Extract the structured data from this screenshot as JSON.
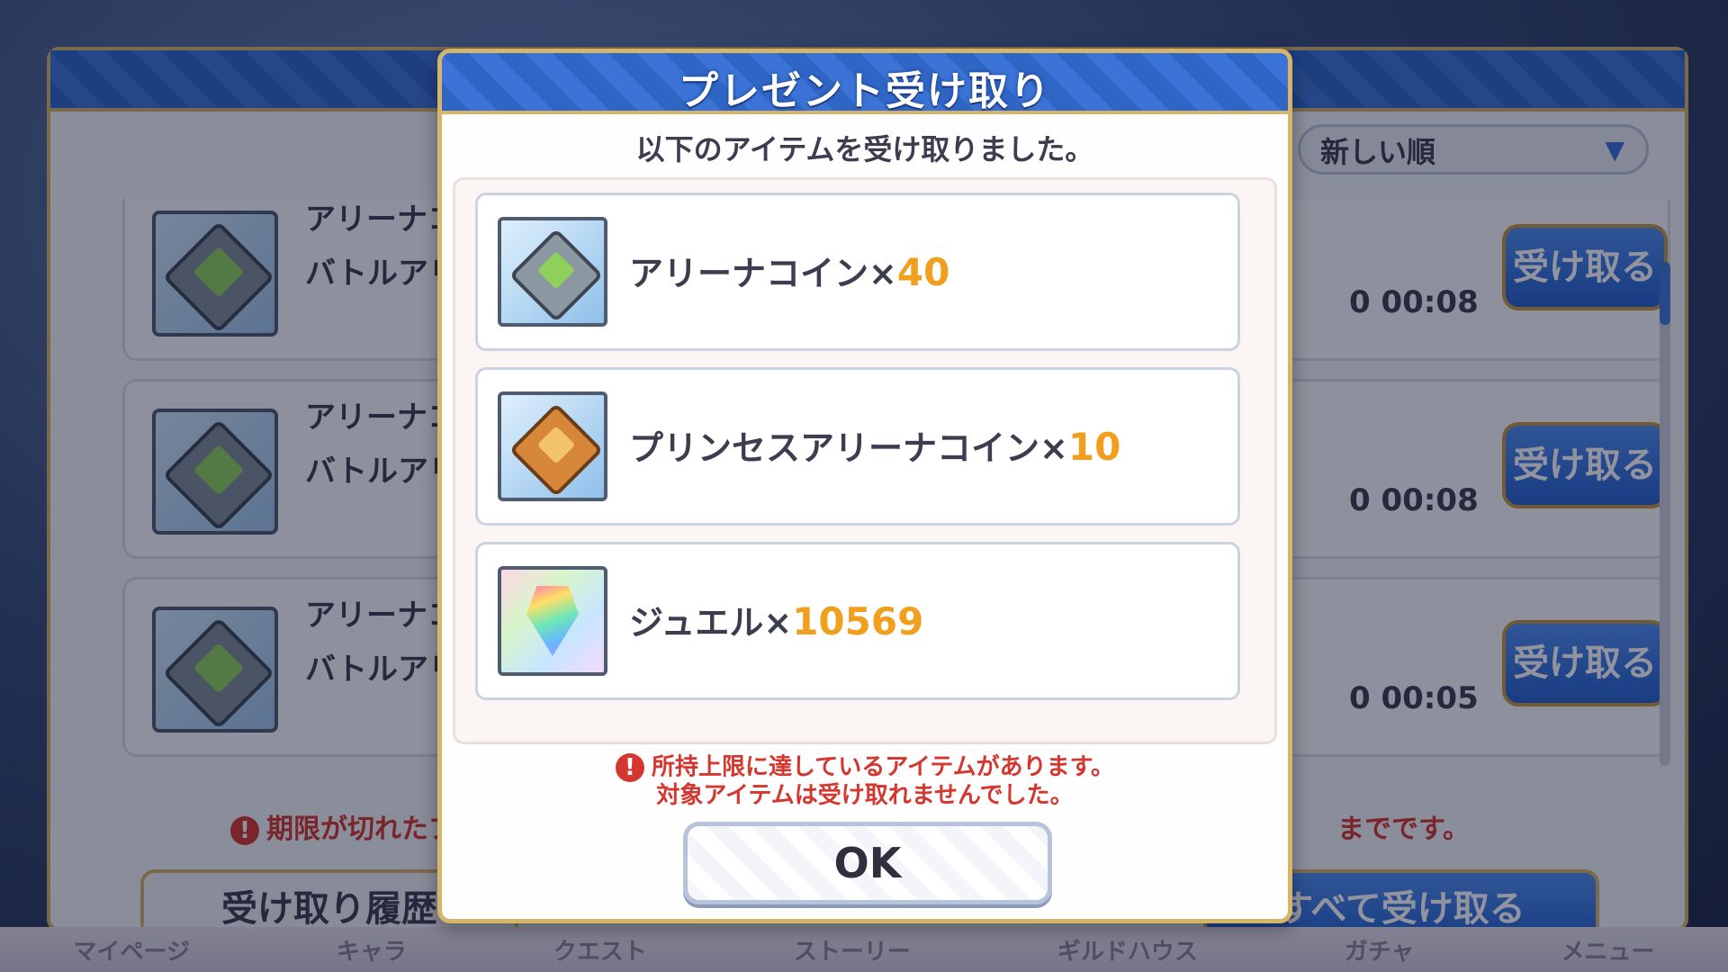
{
  "background_panel": {
    "sort_label": "新しい順",
    "rows": [
      {
        "title": "アリーナコイ",
        "sub": "バトルアリー",
        "date": "0 00:08",
        "button": "受け取る"
      },
      {
        "title": "アリーナコイ",
        "sub": "バトルアリー",
        "date": "0 00:08",
        "button": "受け取る"
      },
      {
        "title": "アリーナコイ",
        "sub": "バトルアリー",
        "date": "0 00:05",
        "button": "受け取る"
      }
    ],
    "warning_left": "期限が切れたプレ",
    "warning_right": "までです。",
    "history_button": "受け取り履歴",
    "claim_all_button": "すべて受け取る",
    "nav": [
      "マイページ",
      "キャラ",
      "クエスト",
      "ストーリー",
      "ギルドハウス",
      "ガチャ",
      "メニュー"
    ]
  },
  "dialog": {
    "title": "プレゼント受け取り",
    "message": "以下のアイテムを受け取りました。",
    "items": [
      {
        "name": "アリーナコイン×",
        "qty": "40",
        "icon": "arena-coin-icon"
      },
      {
        "name": "プリンセスアリーナコイン×",
        "qty": "10",
        "icon": "princess-arena-coin-icon"
      },
      {
        "name": "ジュエル×",
        "qty": "10569",
        "icon": "jewel-icon"
      }
    ],
    "warning_line1": "所持上限に達しているアイテムがあります。",
    "warning_line2": "対象アイテムは受け取れませんでした。",
    "ok_label": "OK"
  }
}
